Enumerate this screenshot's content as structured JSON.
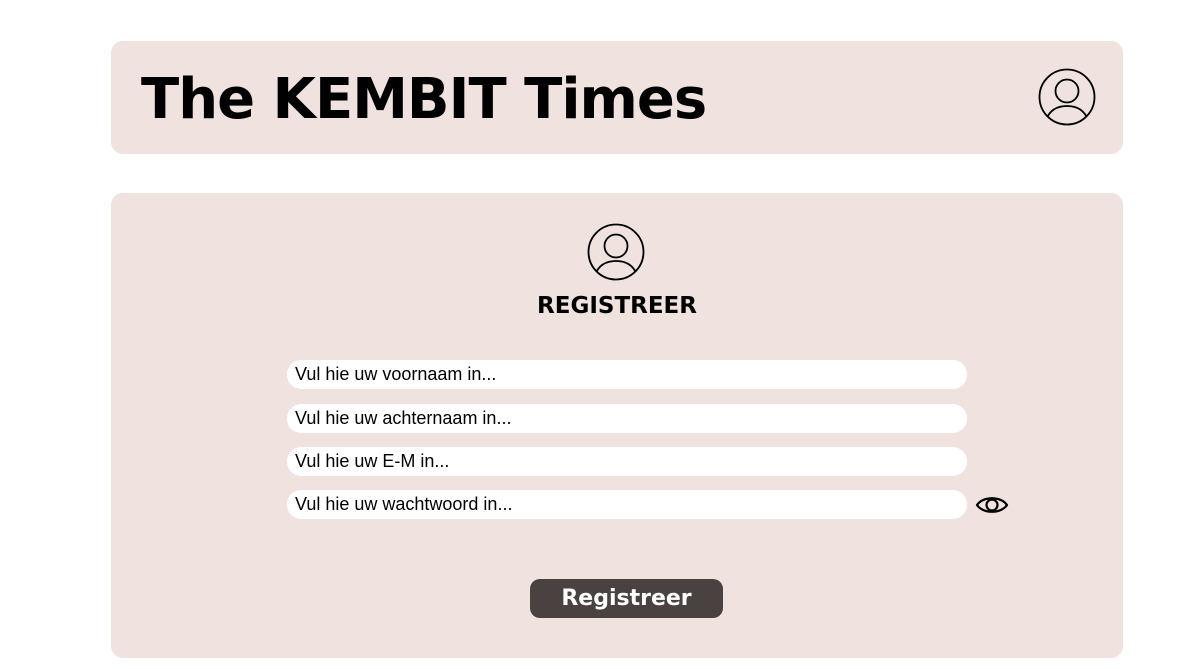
{
  "header": {
    "title": "The KEMBIT Times",
    "account_icon": "user-circle-icon"
  },
  "form": {
    "avatar_icon": "user-circle-icon",
    "title": "REGISTREER",
    "fields": {
      "first_name_placeholder": "Vul hie uw voornaam in...",
      "last_name_placeholder": "Vul hie uw achternaam in...",
      "email_placeholder": "Vul hie uw E-M in...",
      "password_placeholder": "Vul hie uw wachtwoord in..."
    },
    "password_toggle_icon": "eye-icon",
    "submit_label": "Registreer"
  },
  "colors": {
    "page_background": "#ffffff",
    "panel_background": "#efe2df",
    "input_background": "#ffffff",
    "button_background": "#4a4141",
    "button_text": "#ffffff",
    "text": "#000000"
  }
}
